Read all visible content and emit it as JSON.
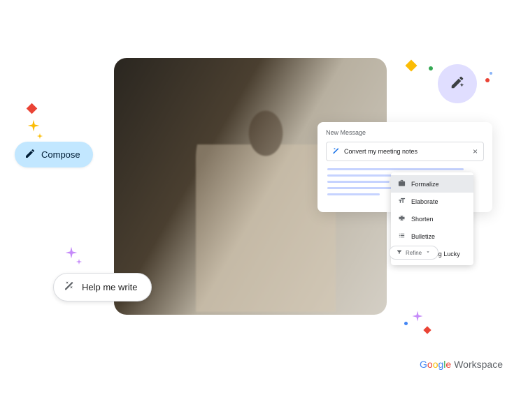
{
  "compose": {
    "label": "Compose"
  },
  "help_write": {
    "label": "Help me write"
  },
  "new_message": {
    "title": "New Message",
    "prompt": "Convert my meeting notes",
    "menu": [
      {
        "label": "Formalize"
      },
      {
        "label": "Elaborate"
      },
      {
        "label": "Shorten"
      },
      {
        "label": "Bulletize"
      },
      {
        "label": "I'm Feeling Lucky"
      }
    ]
  },
  "refine": {
    "label": "Refine"
  },
  "brand": {
    "google": "Google",
    "workspace": "Workspace"
  }
}
